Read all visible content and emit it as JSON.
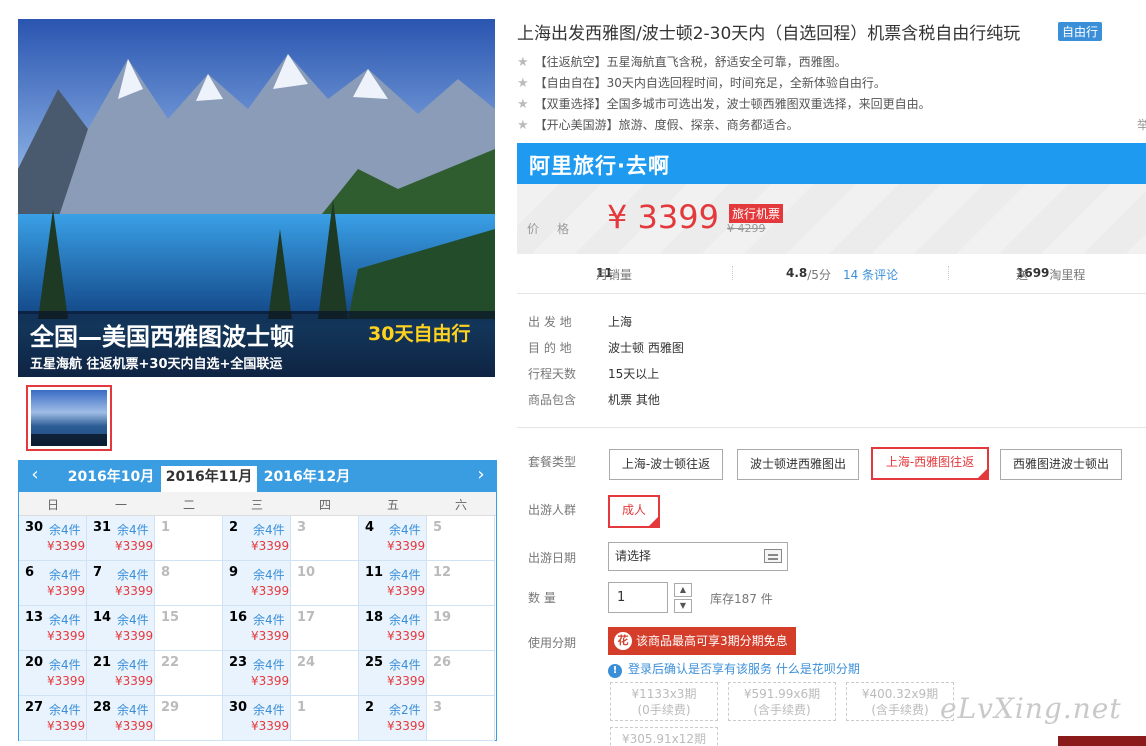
{
  "banner": {
    "title": "全国—美国西雅图波士顿",
    "badge": "30天自由行",
    "subtitle": "五星海航  往返机票+30天内自选+全国联运"
  },
  "calendar": {
    "prev_icon": "chevron-left-icon",
    "next_icon": "chevron-right-icon",
    "arrows": {
      "prev": "‹",
      "next": "›"
    },
    "months": [
      "2016年10月",
      "2016年11月",
      "2016年12月"
    ],
    "active_month": "2016年11月",
    "weekdays": [
      "日",
      "一",
      "二",
      "三",
      "四",
      "五",
      "六"
    ],
    "weeks": [
      [
        {
          "d": "30",
          "s": "余4件",
          "p": "¥3399"
        },
        {
          "d": "31",
          "s": "余4件",
          "p": "¥3399"
        },
        {
          "d": "1"
        },
        {
          "d": "2",
          "s": "余4件",
          "p": "¥3399"
        },
        {
          "d": "3"
        },
        {
          "d": "4",
          "s": "余4件",
          "p": "¥3399"
        },
        {
          "d": "5"
        }
      ],
      [
        {
          "d": "6",
          "s": "余4件",
          "p": "¥3399"
        },
        {
          "d": "7",
          "s": "余4件",
          "p": "¥3399"
        },
        {
          "d": "8"
        },
        {
          "d": "9",
          "s": "余4件",
          "p": "¥3399"
        },
        {
          "d": "10"
        },
        {
          "d": "11",
          "s": "余4件",
          "p": "¥3399"
        },
        {
          "d": "12"
        }
      ],
      [
        {
          "d": "13",
          "s": "余4件",
          "p": "¥3399"
        },
        {
          "d": "14",
          "s": "余4件",
          "p": "¥3399"
        },
        {
          "d": "15"
        },
        {
          "d": "16",
          "s": "余4件",
          "p": "¥3399"
        },
        {
          "d": "17"
        },
        {
          "d": "18",
          "s": "余4件",
          "p": "¥3399"
        },
        {
          "d": "19"
        }
      ],
      [
        {
          "d": "20",
          "s": "余4件",
          "p": "¥3399"
        },
        {
          "d": "21",
          "s": "余4件",
          "p": "¥3399"
        },
        {
          "d": "22"
        },
        {
          "d": "23",
          "s": "余4件",
          "p": "¥3399"
        },
        {
          "d": "24"
        },
        {
          "d": "25",
          "s": "余4件",
          "p": "¥3399"
        },
        {
          "d": "26"
        }
      ],
      [
        {
          "d": "27",
          "s": "余4件",
          "p": "¥3399"
        },
        {
          "d": "28",
          "s": "余4件",
          "p": "¥3399"
        },
        {
          "d": "29"
        },
        {
          "d": "30",
          "s": "余4件",
          "p": "¥3399"
        },
        {
          "d": "1"
        },
        {
          "d": "2",
          "s": "余2件",
          "p": "¥3399"
        },
        {
          "d": "3"
        }
      ]
    ]
  },
  "product": {
    "title": "上海出发西雅图/波士顿2-30天内（自选回程）机票含税自由行纯玩",
    "tag": "自由行",
    "features": [
      "【往返航空】五星海航直飞含税，舒适安全可靠，西雅图。",
      "【自由自在】30天内自选回程时间，时间充足，全新体验自由行。",
      "【双重选择】全国多城市可选出发，波士顿西雅图双重选择，来回更自由。",
      "【开心美国游】旅游、度假、探亲、商务都适合。"
    ],
    "edge_char": "举"
  },
  "price": {
    "brand": "阿里旅行·去啊",
    "label": "价格",
    "current": "¥ 3399",
    "tag": "旅行机票",
    "original": "¥ 4299"
  },
  "stats": {
    "sales_label": "月销量",
    "sales": "11",
    "rating": "4.8",
    "rating_suffix": "/5分",
    "reviews": "14 条评论",
    "points_prefix": "送",
    "points": "1699",
    "points_suffix": "淘里程"
  },
  "info": [
    {
      "label": "出 发 地",
      "value": "上海"
    },
    {
      "label": "目 的 地",
      "value": "波士顿   西雅图"
    },
    {
      "label": "行程天数",
      "value": "15天以上"
    },
    {
      "label": "商品包含",
      "value": "机票   其他"
    }
  ],
  "options": {
    "package_label": "套餐类型",
    "packages": [
      "上海-波士顿往返",
      "波士顿进西雅图出",
      "上海-西雅图往返",
      "西雅图进波士顿出"
    ],
    "selected_package": "上海-西雅图往返",
    "crowd_label": "出游人群",
    "crowd": "成人",
    "date_label": "出游日期",
    "date_value": "请选择",
    "qty_label": "数    量",
    "qty_value": "1",
    "stock": "库存187 件",
    "inst_label": "使用分期",
    "huabei_icon": "huabei-logo-icon",
    "huabei_glyph": "花",
    "huabei_text": "该商品最高可享3期分期免息",
    "notice_glyph": "!",
    "notice_text": "登录后确认是否享有该服务",
    "notice_link": "什么是花呗分期",
    "installments": [
      {
        "amount": "¥1133x3期",
        "fee": "(0手续费)"
      },
      {
        "amount": "¥591.99x6期",
        "fee": "(含手续费)"
      },
      {
        "amount": "¥400.32x9期",
        "fee": "(含手续费)"
      },
      {
        "amount": "¥305.91x12期",
        "fee": ""
      }
    ]
  },
  "watermark": "eLvXing.net"
}
